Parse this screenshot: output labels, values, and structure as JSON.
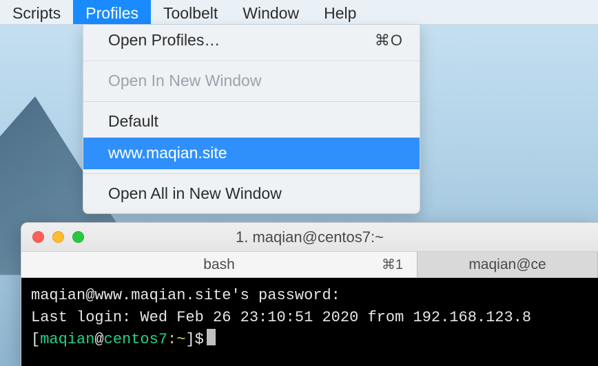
{
  "menubar": {
    "items": [
      {
        "label": "Scripts",
        "active": false
      },
      {
        "label": "Profiles",
        "active": true
      },
      {
        "label": "Toolbelt",
        "active": false
      },
      {
        "label": "Window",
        "active": false
      },
      {
        "label": "Help",
        "active": false
      }
    ]
  },
  "dropdown": {
    "open_profiles": {
      "label": "Open Profiles…",
      "shortcut": "⌘O"
    },
    "open_in_new_window": {
      "label": "Open In New Window"
    },
    "profile_default": {
      "label": "Default"
    },
    "profile_selected": {
      "label": "www.maqian.site"
    },
    "open_all": {
      "label": "Open All in New Window"
    }
  },
  "window": {
    "title": "1. maqian@centos7:~",
    "tabs": [
      {
        "label": "bash",
        "shortcut": "⌘1",
        "active": true
      },
      {
        "label": "maqian@ce",
        "active": false
      }
    ]
  },
  "terminal": {
    "line1": "maqian@www.maqian.site's password:",
    "line2": "Last login: Wed Feb 26 23:10:51 2020 from 192.168.123.8",
    "prompt": {
      "open": "[",
      "user": "maqian",
      "at": "@",
      "host": "centos7",
      "sep": ":",
      "path": "~",
      "close": "]$"
    }
  }
}
